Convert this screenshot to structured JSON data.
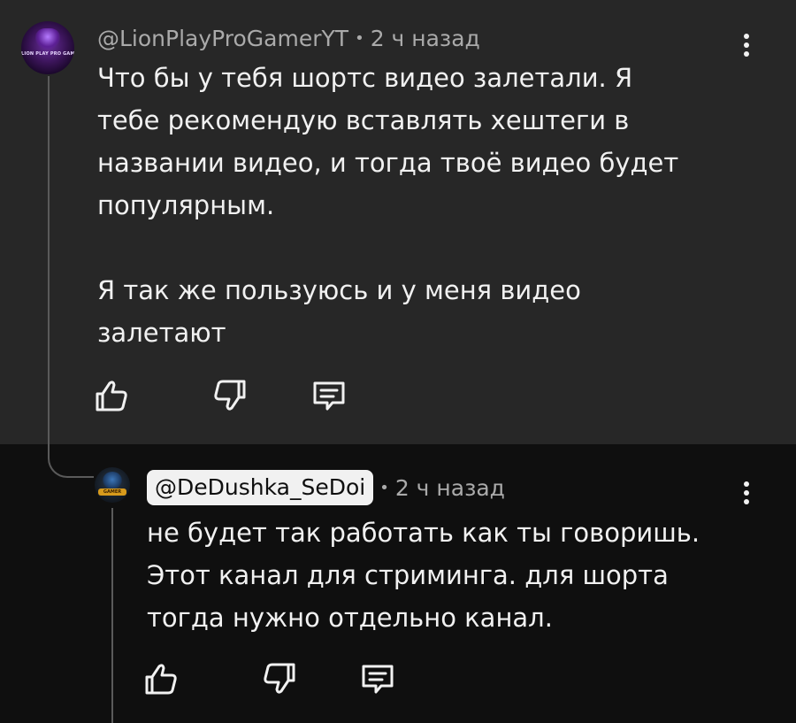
{
  "comment": {
    "author": "@LionPlayProGamerYT",
    "time": "2 ч назад",
    "avatar_text": "LION PLAY PRO GAMER",
    "text": "Что бы у тебя шортс видео залетали. Я\nтебе рекомендую вставлять хештеги в\nназвании видео, и тогда твоё видео будет\nпопулярным.\n\nЯ так же пользуюсь и у меня видео\nзалетают"
  },
  "reply": {
    "author": "@DeDushka_SeDoi",
    "time": "2 ч назад",
    "avatar_text": "GAMER",
    "text": "не будет так работать как ты говоришь.\nЭтот канал для стриминга.  для шорта\nтогда нужно отдельно канал."
  },
  "separator": "•",
  "icons": {
    "like": "thumb-up-icon",
    "dislike": "thumb-down-icon",
    "reply": "comment-icon",
    "menu": "more-vertical-icon"
  },
  "colors": {
    "comment_bg": "#272727",
    "reply_bg": "#0f0f0f",
    "text": "#f1f1f1",
    "meta": "#aaaaaa",
    "handle_pill_bg": "#f1f1f1"
  }
}
